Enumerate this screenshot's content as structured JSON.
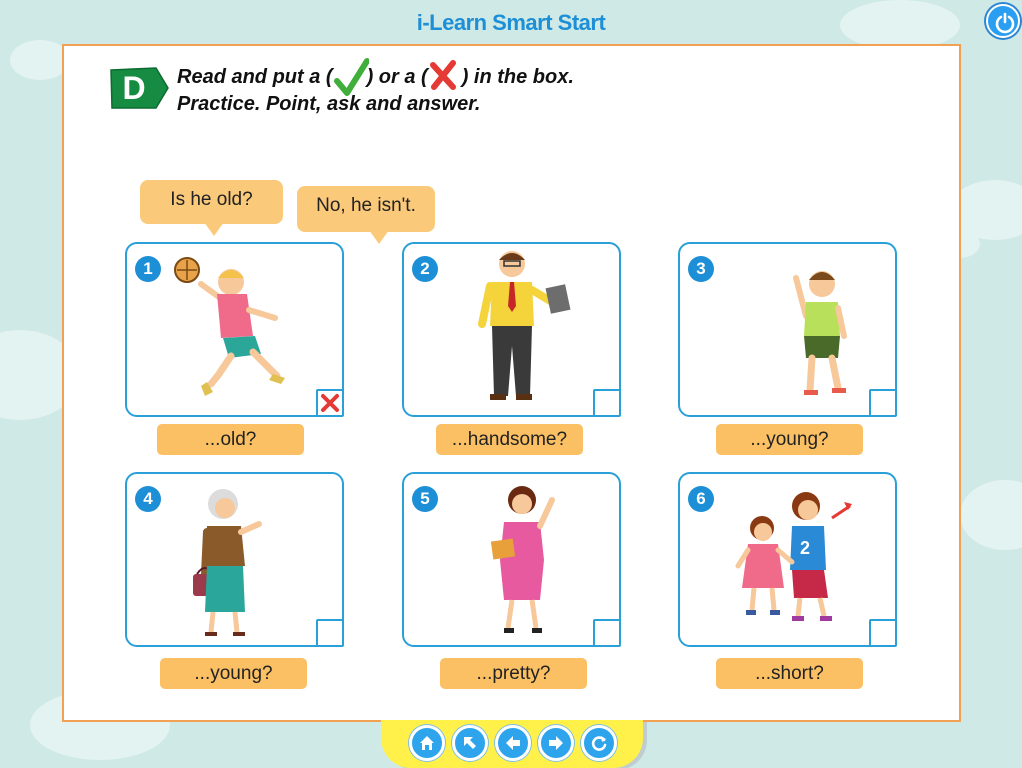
{
  "app": {
    "title": "i-Learn Smart Start"
  },
  "header_controls": {
    "power_icon": "power-icon"
  },
  "section": {
    "letter": "D",
    "instruction_part1": "Read and put a (",
    "instruction_part2": ") or a (",
    "instruction_part3": ") in the box.",
    "instruction_line2": "Practice. Point, ask and answer."
  },
  "bubbles": {
    "question": "Is he old?",
    "answer": "No, he isn't."
  },
  "cards": [
    {
      "number": "1",
      "label": "...old?",
      "mark": "cross",
      "figure": "boy-playing-ball"
    },
    {
      "number": "2",
      "label": "...handsome?",
      "mark": "",
      "figure": "man-with-tablet"
    },
    {
      "number": "3",
      "label": "...young?",
      "mark": "",
      "figure": "boy-waving"
    },
    {
      "number": "4",
      "label": "...young?",
      "mark": "",
      "figure": "old-woman-with-bag"
    },
    {
      "number": "5",
      "label": "...pretty?",
      "mark": "",
      "figure": "woman-with-books"
    },
    {
      "number": "6",
      "label": "...short?",
      "mark": "",
      "figure": "two-girls"
    }
  ],
  "nav": {
    "buttons": [
      "home-icon",
      "arrow-up-left-icon",
      "arrow-left-icon",
      "arrow-right-icon",
      "refresh-icon"
    ]
  },
  "colors": {
    "accent_blue": "#1d8fd6",
    "frame_orange": "#f2a154",
    "pill_orange": "#fbc064",
    "badge_green": "#168c43",
    "nav_yellow": "#fff04a"
  }
}
